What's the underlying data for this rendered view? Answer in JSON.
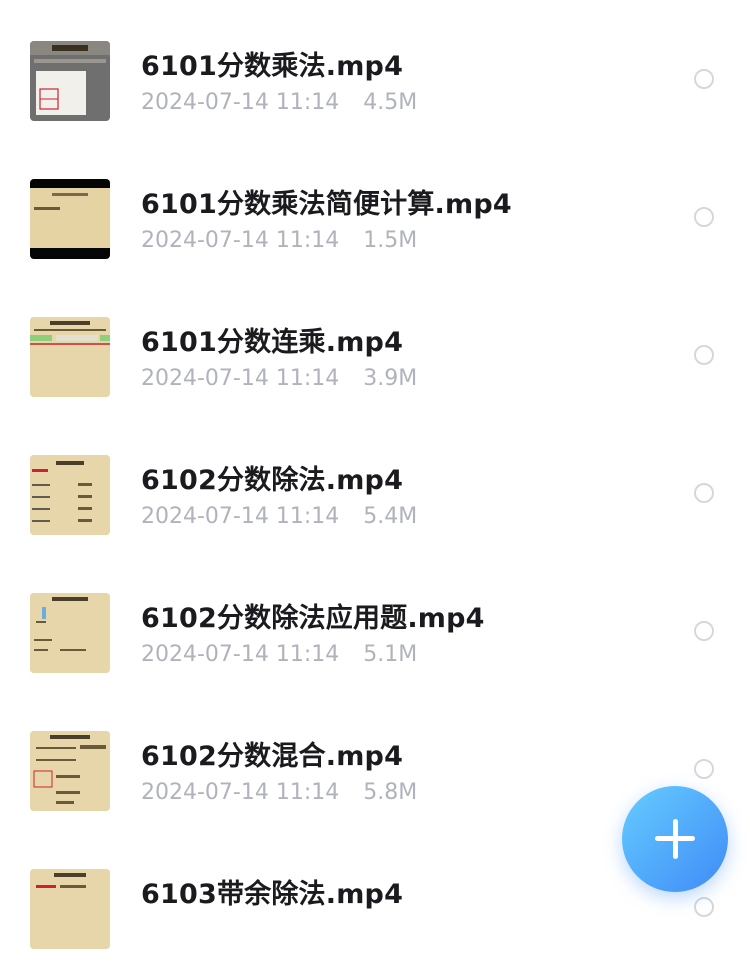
{
  "files": [
    {
      "name": "6101分数乘法.mp4",
      "date": "2024-07-14 11:14",
      "size": "4.5M",
      "thumb_title": "分数乘法",
      "thumb_style": "gray"
    },
    {
      "name": "6101分数乘法简便计算.mp4",
      "date": "2024-07-14 11:14",
      "size": "1.5M",
      "thumb_title": "分数乘法简便运算",
      "thumb_style": "letterbox"
    },
    {
      "name": "6101分数连乘.mp4",
      "date": "2024-07-14 11:14",
      "size": "3.9M",
      "thumb_title": "分数连乘应用题",
      "thumb_style": "paper"
    },
    {
      "name": "6102分数除法.mp4",
      "date": "2024-07-14 11:14",
      "size": "5.4M",
      "thumb_title": "分数除法",
      "thumb_style": "paper"
    },
    {
      "name": "6102分数除法应用题.mp4",
      "date": "2024-07-14 11:14",
      "size": "5.1M",
      "thumb_title": "分数除法应用题",
      "thumb_style": "paper"
    },
    {
      "name": "6102分数混合.mp4",
      "date": "2024-07-14 11:14",
      "size": "5.8M",
      "thumb_title": "分数除法混合运算",
      "thumb_style": "paper"
    },
    {
      "name": "6103带余除法.mp4",
      "date": "",
      "size": "",
      "thumb_title": "带余除法",
      "thumb_style": "paper"
    }
  ],
  "fab": {
    "icon": "plus-icon"
  },
  "colors": {
    "accent": "#3f8bf7",
    "accent_light": "#66ccff",
    "meta_text": "#b0b3bb",
    "title_text": "#1b1b1f"
  }
}
